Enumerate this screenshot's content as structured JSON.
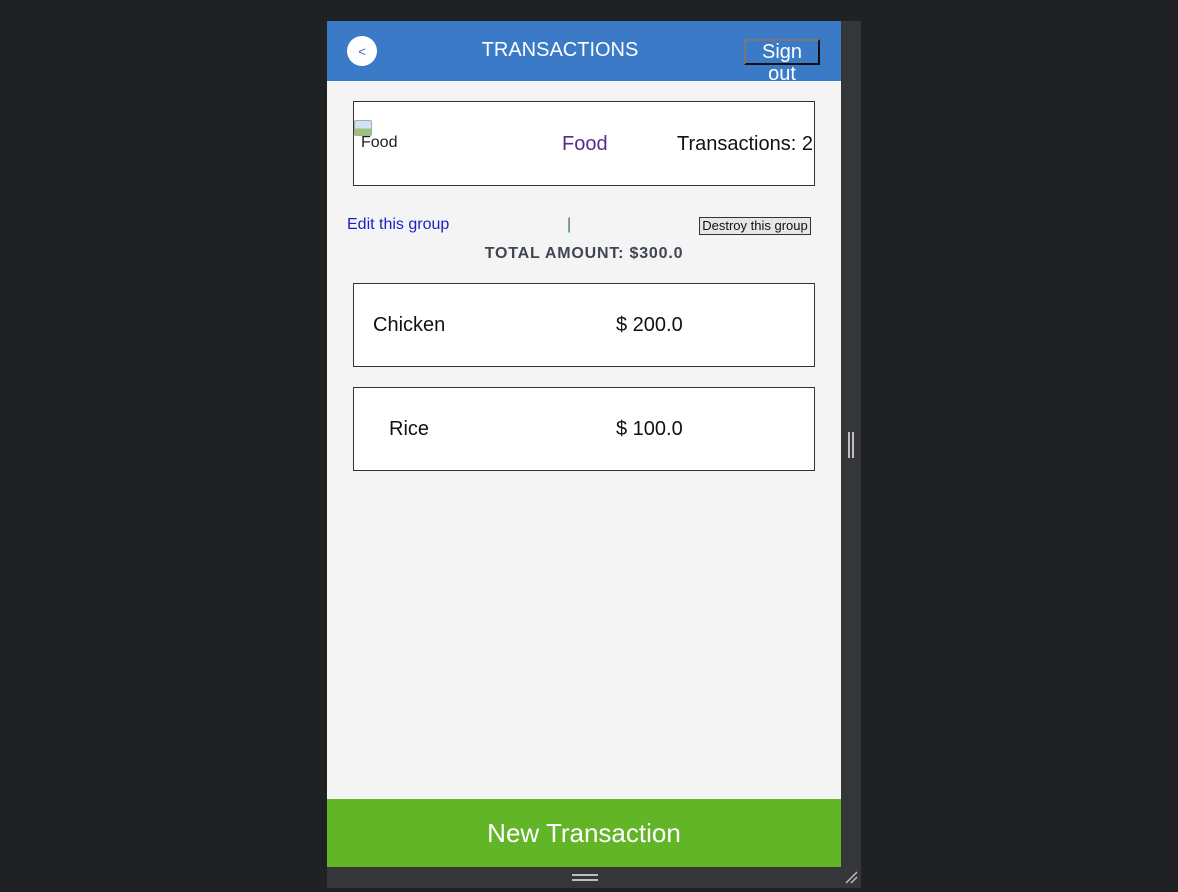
{
  "header": {
    "back_label": "<",
    "title": "TRANSACTIONS",
    "signout_label": "Sign out"
  },
  "group": {
    "image_alt": "Food",
    "name": "Food",
    "transactions_count": "Transactions: 2"
  },
  "actions": {
    "edit_label": "Edit this group",
    "separator": "|",
    "destroy_label": "Destroy this group"
  },
  "total_amount": "TOTAL AMOUNT: $300.0",
  "transactions": [
    {
      "name": "Chicken",
      "amount": "$ 200.0"
    },
    {
      "name": "Rice",
      "amount": "$ 100.0"
    }
  ],
  "footer": {
    "new_transaction_label": "New Transaction"
  },
  "colors": {
    "header": "#3a7ac6",
    "new_transaction": "#62b526",
    "group_name": "#5a2a8f",
    "link": "#1a1fc9"
  }
}
